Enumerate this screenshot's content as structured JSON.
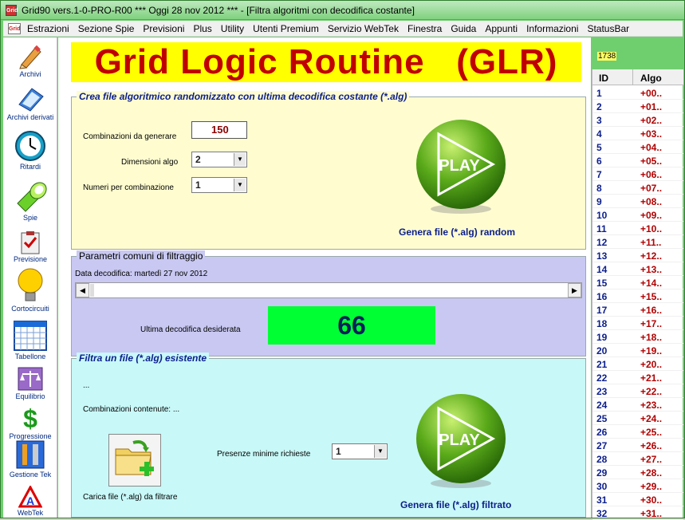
{
  "window": {
    "title": "Grid90 vers.1-0-PRO-R00  ***  Oggi 28 nov 2012  ***   - [Filtra algoritmi con decodifica costante]",
    "app_icon_text": "Grid"
  },
  "menu": {
    "items": [
      "Estrazioni",
      "Sezione Spie",
      "Previsioni",
      "Plus",
      "Utility",
      "Utenti Premium",
      "Servizio WebTek",
      "Finestra",
      "Guida",
      "Appunti",
      "Informazioni",
      "StatusBar"
    ]
  },
  "toolbar": {
    "items": [
      {
        "label": "Archivi",
        "icon": "pencil-icon"
      },
      {
        "label": "Archivi derivati",
        "icon": "notebook-icon"
      },
      {
        "label": "Ritardi",
        "icon": "clock-icon"
      },
      {
        "label": "Spie",
        "icon": "flashlight-icon"
      },
      {
        "label": "Previsione",
        "icon": "clipboard-check-icon"
      },
      {
        "label": "Cortocircuiti",
        "icon": "lightbulb-icon"
      },
      {
        "label": "Tabellone",
        "icon": "calendar-grid-icon"
      },
      {
        "label": "Equilibrio",
        "icon": "scales-icon"
      },
      {
        "label": "Progressione",
        "icon": "dollar-icon"
      },
      {
        "label": "Gestione Tek",
        "icon": "tools-icon"
      },
      {
        "label": "WebTek",
        "icon": "webtek-icon"
      }
    ]
  },
  "banner": {
    "title": "Grid Logic Routine   (GLR)"
  },
  "counter": "1738",
  "section1": {
    "legend": "Crea file algoritmico randomizzato con ultima decodifica costante (*.alg)",
    "comb_label": "Combinazioni da generare",
    "comb_value": "150",
    "dim_label": "Dimensioni algo",
    "dim_value": "2",
    "num_label": "Numeri per combinazione",
    "num_value": "1",
    "play_text": "PLAY",
    "play_caption": "Genera file (*.alg) random"
  },
  "section2": {
    "legend": "Parametri comuni di filtraggio",
    "date_label": "Data decodifica: martedì 27 nov 2012",
    "last_label": "Ultima decodifica desiderata",
    "last_value": "66"
  },
  "section3": {
    "legend": "Filtra un file (*.alg) esistente",
    "dots": "...",
    "comb_contained": "Combinazioni contenute: ...",
    "presence_label": "Presenze minime richieste",
    "presence_value": "1",
    "load_label": "Carica file (*.alg) da filtrare",
    "play_text": "PLAY",
    "play_caption": "Genera file (*.alg) filtrato"
  },
  "table": {
    "headers": [
      "ID",
      "Algo"
    ],
    "rows": [
      [
        "1",
        "+00.."
      ],
      [
        "2",
        "+01.."
      ],
      [
        "3",
        "+02.."
      ],
      [
        "4",
        "+03.."
      ],
      [
        "5",
        "+04.."
      ],
      [
        "6",
        "+05.."
      ],
      [
        "7",
        "+06.."
      ],
      [
        "8",
        "+07.."
      ],
      [
        "9",
        "+08.."
      ],
      [
        "10",
        "+09.."
      ],
      [
        "11",
        "+10.."
      ],
      [
        "12",
        "+11.."
      ],
      [
        "13",
        "+12.."
      ],
      [
        "14",
        "+13.."
      ],
      [
        "15",
        "+14.."
      ],
      [
        "16",
        "+15.."
      ],
      [
        "17",
        "+16.."
      ],
      [
        "18",
        "+17.."
      ],
      [
        "19",
        "+18.."
      ],
      [
        "20",
        "+19.."
      ],
      [
        "21",
        "+20.."
      ],
      [
        "22",
        "+21.."
      ],
      [
        "23",
        "+22.."
      ],
      [
        "24",
        "+23.."
      ],
      [
        "25",
        "+24.."
      ],
      [
        "26",
        "+25.."
      ],
      [
        "27",
        "+26.."
      ],
      [
        "28",
        "+27.."
      ],
      [
        "29",
        "+28.."
      ],
      [
        "30",
        "+29.."
      ],
      [
        "31",
        "+30.."
      ],
      [
        "32",
        "+31.."
      ]
    ]
  },
  "colors": {
    "accent": "#c00000",
    "banner_bg": "#ffff00",
    "value_green": "#00ff33",
    "title_blue": "#0b1e8c"
  }
}
